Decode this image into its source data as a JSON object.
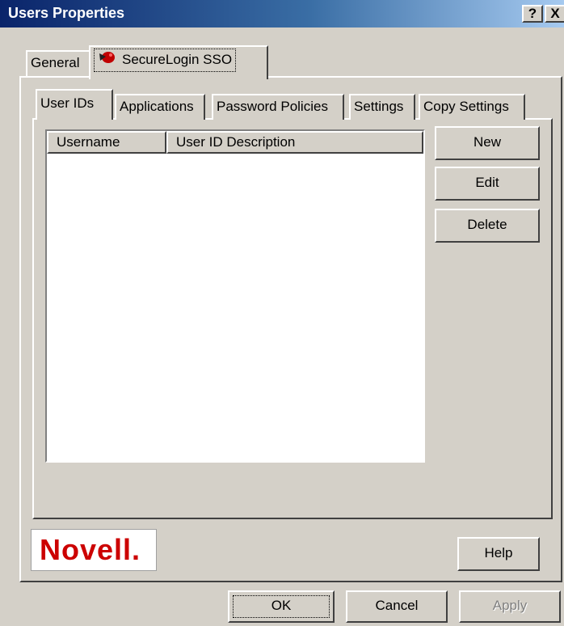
{
  "window": {
    "title": "Users Properties",
    "help_glyph": "?",
    "close_glyph": "X"
  },
  "outer_tabs": [
    {
      "label": "General"
    },
    {
      "label": "SecureLogin SSO",
      "icon": "securelogin-icon"
    }
  ],
  "inner_tabs": [
    {
      "label": "User IDs"
    },
    {
      "label": "Applications"
    },
    {
      "label": "Password Policies"
    },
    {
      "label": "Settings"
    },
    {
      "label": "Copy Settings"
    }
  ],
  "list": {
    "columns": [
      "Username",
      "User ID Description"
    ],
    "rows": []
  },
  "side_buttons": {
    "new": "New",
    "edit": "Edit",
    "delete": "Delete"
  },
  "logo": {
    "text": "Novell",
    "dot": ".",
    "color": "#cc0000"
  },
  "footer": {
    "help": "Help",
    "ok": "OK",
    "cancel": "Cancel",
    "apply": "Apply"
  },
  "colors": {
    "titlebar_start": "#0a246a",
    "titlebar_end": "#a6caf0",
    "face": "#d4d0c8"
  }
}
